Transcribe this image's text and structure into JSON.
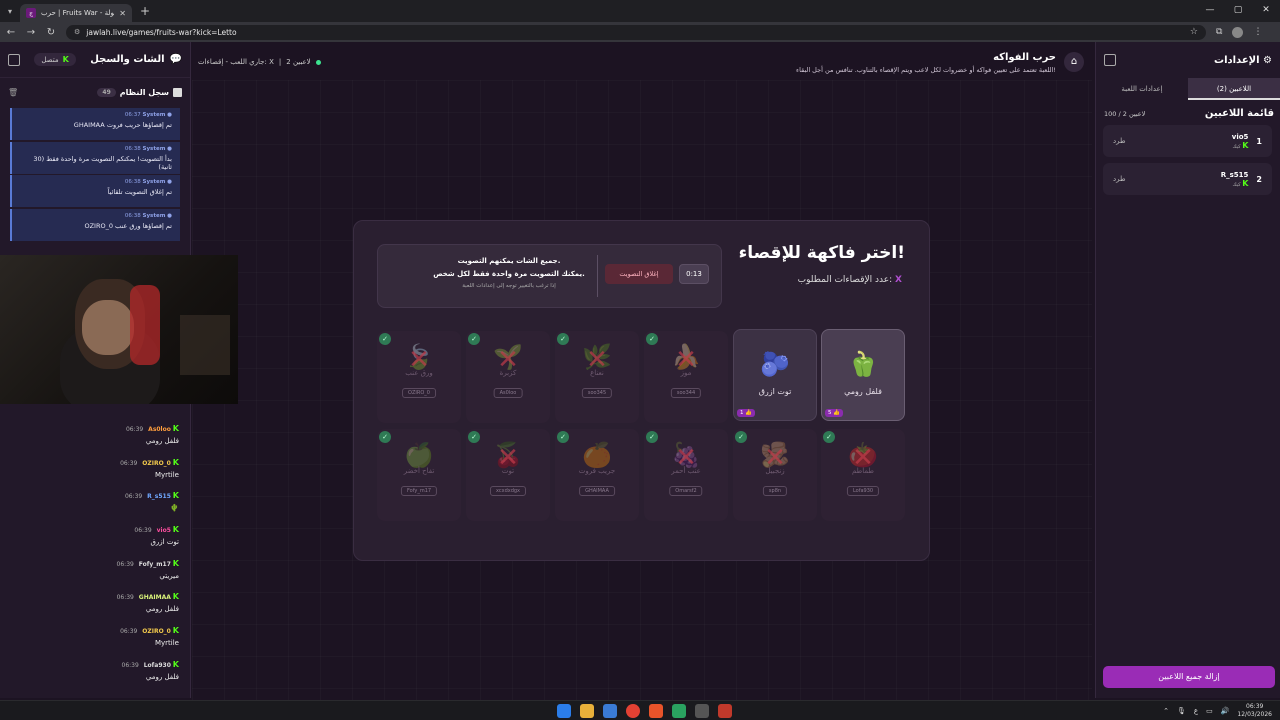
{
  "browser": {
    "tab_title": "حرب | Fruits War - جولة",
    "url": "jawlah.live/games/fruits-war?kick=Letto"
  },
  "header": {
    "game_title": "حرب الفواكه",
    "game_desc": "اللعبة تعتمد على تعيين فواكه أو خضروات لكل لاعب ويتم الإقصاء بالتناوب. تنافس من أجل البقاء!",
    "status_players": "2 لاعبين",
    "status_separator": "|",
    "status_text": "جاري اللعب - إقصاءات: X"
  },
  "left": {
    "title": "الشات والسجل",
    "connected": "متصل",
    "system_log_title": "سجل النظام",
    "system_log_count": "49",
    "system_logs": [
      {
        "time": "06:37",
        "sender": "System",
        "msg": "GHAIMAA تم إقصاؤها حريب فروت"
      },
      {
        "time": "06:38",
        "sender": "System",
        "msg": "بدأ التصويت! يمكنكم التصويت مرة واحدة فقط (30 ثانية)"
      },
      {
        "time": "06:38",
        "sender": "System",
        "msg": "تم إغلاق التصويت تلقائياً"
      },
      {
        "time": "06:38",
        "sender": "System",
        "msg": "OZIRO_0 تم إقصاؤها ورق عنب"
      }
    ],
    "chat": [
      {
        "time": "06:39",
        "user": "As0loo",
        "color": "#ff9e3d",
        "msg": "فلفل رومي"
      },
      {
        "time": "06:39",
        "user": "OZIRO_0",
        "color": "#f2c94c",
        "msg": "Myrtile"
      },
      {
        "time": "06:39",
        "user": "R_s515",
        "color": "#6fa8ff",
        "msg": "🌵"
      },
      {
        "time": "06:39",
        "user": "vio5",
        "color": "#ff4fa0",
        "msg": "توت ازرق"
      },
      {
        "time": "06:39",
        "user": "Fofy_m17",
        "color": "#dddddd",
        "msg": "ميريتي"
      },
      {
        "time": "06:39",
        "user": "GHAIMAA",
        "color": "#d9f27a",
        "msg": "فلفل رومي"
      },
      {
        "time": "06:39",
        "user": "OZIRO_0",
        "color": "#f2c94c",
        "msg": "Myrtile"
      },
      {
        "time": "06:39",
        "user": "Lofa930",
        "color": "#dddddd",
        "msg": "فلفل رومي"
      }
    ]
  },
  "right": {
    "title": "الإعدادات",
    "tab_players": "اللاعبين (2)",
    "tab_settings": "إعدادات اللعبة",
    "list_title": "قائمة اللاعبين",
    "list_count": "100 / 2 لاعبين",
    "kick_label": "طرد",
    "players": [
      {
        "num": "1",
        "name": "vio5",
        "sub": "كيك"
      },
      {
        "num": "2",
        "name": "R_s515",
        "sub": "كيك"
      }
    ],
    "remove_all": "إزالة جميع اللاعبين"
  },
  "card": {
    "title": "اختر فاكهة للإقصاء!",
    "subtitle": "عدد الإقصاءات المطلوب:",
    "subtitle_x": "X",
    "timer": "0:13",
    "close_vote": "إغلاق التصويت",
    "vote_l1": "جميع الشات يمكنهم التصويت.",
    "vote_l2": "يمكنك التصويت مرة واحدة فقط لكل شخص.",
    "vote_l3": "إذا ترغب بالتغيير توجه إلى إعدادات اللعبة",
    "alive_fruits": [
      {
        "name": "فلفل رومي",
        "emoji": "🫑",
        "votes": "5 👍"
      },
      {
        "name": "توت ازرق",
        "emoji": "🫐",
        "votes": "1 👍"
      }
    ],
    "eliminated_row1": [
      {
        "name": "موز",
        "emoji": "🍌",
        "owner": "soo344"
      },
      {
        "name": "نعناع",
        "emoji": "🌿",
        "owner": "soo345"
      },
      {
        "name": "كزبرة",
        "emoji": "🌱",
        "owner": "As0loo"
      },
      {
        "name": "ورق عنب",
        "emoji": "🍃",
        "owner": "OZIRO_0"
      }
    ],
    "eliminated_row2": [
      {
        "name": "طماطم",
        "emoji": "🍅",
        "owner": "Lofa930"
      },
      {
        "name": "زنجبيل",
        "emoji": "🫚",
        "owner": "sp8n"
      },
      {
        "name": "عنب أحمر",
        "emoji": "🍇",
        "owner": "Omarsf2"
      },
      {
        "name": "جريب فروت",
        "emoji": "🍊",
        "owner": "GHAIMAA"
      },
      {
        "name": "توت",
        "emoji": "🍒",
        "owner": "xcxdxdgx"
      },
      {
        "name": "تفاح أخضر",
        "emoji": "🍏",
        "owner": "Fofy_m17"
      }
    ]
  },
  "taskbar": {
    "time": "06:39",
    "date": "12/03/2026",
    "lang": "ع"
  }
}
